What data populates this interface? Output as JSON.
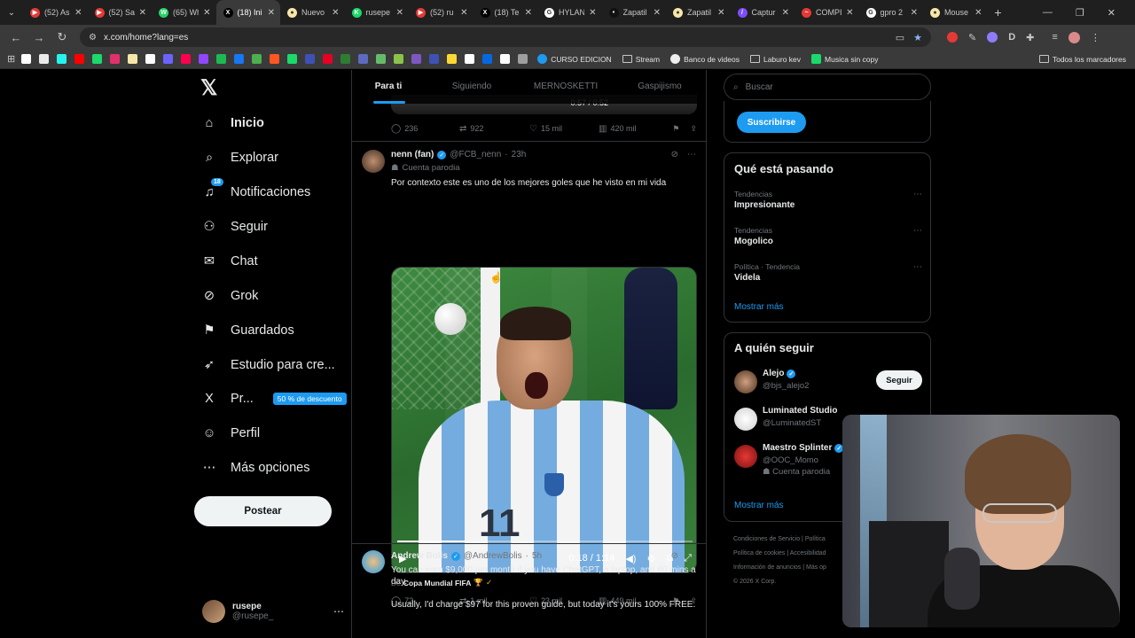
{
  "browser": {
    "tabs": [
      {
        "label": "(52) As",
        "fav_color": "#e53935",
        "fav_glyph": "▶"
      },
      {
        "label": "(52) Sa",
        "fav_color": "#e53935",
        "fav_glyph": "▶"
      },
      {
        "label": "(65) Wh",
        "fav_color": "#25d366",
        "fav_glyph": "W"
      },
      {
        "label": "(18) Ini",
        "fav_color": "#000000",
        "fav_glyph": "X",
        "active": true
      },
      {
        "label": "Nuevo",
        "fav_color": "#f6e6a8",
        "fav_glyph": "●"
      },
      {
        "label": "rusepe",
        "fav_color": "#1bd96a",
        "fav_glyph": "K"
      },
      {
        "label": "(52) ru",
        "fav_color": "#e53935",
        "fav_glyph": "▶"
      },
      {
        "label": "(18) Te",
        "fav_color": "#000000",
        "fav_glyph": "X"
      },
      {
        "label": "HYLAN",
        "fav_color": "#ffffff",
        "fav_glyph": "G"
      },
      {
        "label": "Zapatil",
        "fav_color": "#111111",
        "fav_glyph": "•"
      },
      {
        "label": "Zapatil",
        "fav_color": "#f6e6a8",
        "fav_glyph": "●"
      },
      {
        "label": "Captur",
        "fav_color": "#7c4dff",
        "fav_glyph": "/"
      },
      {
        "label": "COMPI",
        "fav_color": "#e53935",
        "fav_glyph": "~"
      },
      {
        "label": "gpro 2",
        "fav_color": "#ffffff",
        "fav_glyph": "G"
      },
      {
        "label": "Mouse",
        "fav_color": "#f6e6a8",
        "fav_glyph": "●"
      }
    ],
    "url": "x.com/home?lang=es",
    "bookmarks": [
      {
        "label": "",
        "color": "#ffffff"
      },
      {
        "label": "",
        "color": "#eaeaea"
      },
      {
        "label": "",
        "color": "#25f4ee"
      },
      {
        "label": "",
        "color": "#ff0000"
      },
      {
        "label": "",
        "color": "#1bd96a"
      },
      {
        "label": "",
        "color": "#e1306c"
      },
      {
        "label": "",
        "color": "#f6e6a8"
      },
      {
        "label": "",
        "color": "#ffffff"
      },
      {
        "label": "",
        "color": "#6c63ff"
      },
      {
        "label": "",
        "color": "#ff0050"
      },
      {
        "label": "",
        "color": "#9146ff"
      },
      {
        "label": "",
        "color": "#1db954"
      },
      {
        "label": "",
        "color": "#1877f2"
      },
      {
        "label": "",
        "color": "#4caf50"
      },
      {
        "label": "",
        "color": "#ff5722"
      },
      {
        "label": "",
        "color": "#1bd96a"
      },
      {
        "label": "",
        "color": "#3f51b5"
      },
      {
        "label": "",
        "color": "#e60023"
      },
      {
        "label": "",
        "color": "#2e7d32"
      },
      {
        "label": "",
        "color": "#5c6bc0"
      },
      {
        "label": "",
        "color": "#66bb6a"
      },
      {
        "label": "",
        "color": "#8bc34a"
      },
      {
        "label": "",
        "color": "#7e57c2"
      },
      {
        "label": "",
        "color": "#3f51b5"
      },
      {
        "label": "",
        "color": "#fdd835"
      },
      {
        "label": "",
        "color": "#ffffff"
      },
      {
        "label": "",
        "color": "#0668e1"
      },
      {
        "label": "",
        "color": "#ffffff"
      },
      {
        "label": "",
        "color": "#9e9e9e"
      }
    ],
    "bookmark_links": [
      {
        "label": "CURSO EDICION",
        "icon": "S"
      },
      {
        "label": "Stream",
        "icon": "folder"
      },
      {
        "label": "Banco de videos",
        "icon": "o"
      },
      {
        "label": "Laburo kev",
        "icon": "folder"
      },
      {
        "label": "Musica sin copy",
        "icon": "music"
      }
    ],
    "all_bookmarks": "Todos los marcadores"
  },
  "leftnav": {
    "items": [
      {
        "label": "Inicio",
        "icon": "home-icon",
        "glyph": "⌂",
        "bold": true
      },
      {
        "label": "Explorar",
        "icon": "search-icon",
        "glyph": "⌕"
      },
      {
        "label": "Notificaciones",
        "icon": "bell-icon",
        "glyph": "♫",
        "badge": "18"
      },
      {
        "label": "Seguir",
        "icon": "add-person-icon",
        "glyph": "⚇"
      },
      {
        "label": "Chat",
        "icon": "mail-icon",
        "glyph": "✉"
      },
      {
        "label": "Grok",
        "icon": "grok-icon",
        "glyph": "⊘"
      },
      {
        "label": "Guardados",
        "icon": "bookmark-icon",
        "glyph": "⚑"
      },
      {
        "label": "Estudio para cre...",
        "icon": "rocket-icon",
        "glyph": "➶"
      },
      {
        "label": "Pr...",
        "icon": "x-premium-icon",
        "glyph": "X",
        "promo": "50 % de descuento"
      },
      {
        "label": "Perfil",
        "icon": "person-icon",
        "glyph": "☺"
      },
      {
        "label": "Más opciones",
        "icon": "more-icon",
        "glyph": "⋯"
      }
    ],
    "post_label": "Postear",
    "profile": {
      "name": "rusepe",
      "handle": "@rusepe_"
    }
  },
  "timeline": {
    "tabs": [
      "Para ti",
      "Siguiendo",
      "MERNOSKETTI",
      "Gaspijismo"
    ],
    "prev_post": {
      "time": "0:57 / 0:52",
      "replies": "236",
      "reposts": "922",
      "likes": "15 mil",
      "views": "420 mil"
    },
    "post1": {
      "name": "nenn (fan)",
      "handle": "@FCB_nenn",
      "age": "23h",
      "parody": "Cuenta parodia",
      "text": "Por contexto este es uno de los mejores goles que he visto en mi vida",
      "video_time": "0:18 / 1:14",
      "progress": 0.24,
      "jersey_number": "11",
      "source_prefix": "De",
      "source": "Copa Mundial FIFA",
      "replies": "72",
      "reposts": "1 mil",
      "likes": "23 mil",
      "views": "449 mil"
    },
    "post2": {
      "name": "Andrew Bolis",
      "handle": "@AndrewBolis",
      "age": "5h",
      "text1": "You can earn $9,000 per month if you have ChatGPT, a laptop, and 60 mins a day.",
      "text2": "Usually, I'd charge $97 for this proven guide, but today it's yours 100% FREE."
    }
  },
  "rightcol": {
    "search_placeholder": "Buscar",
    "subscribe_label": "Suscribirse",
    "trends_title": "Qué está pasando",
    "trends": [
      {
        "context": "Tendencias",
        "name": "Impresionante"
      },
      {
        "context": "Tendencias",
        "name": "Mogolico"
      },
      {
        "context": "Política · Tendencia",
        "name": "Videla"
      }
    ],
    "show_more": "Mostrar más",
    "follow_title": "A quién seguir",
    "follow": [
      {
        "name": "Alejo",
        "handle": "@bjs_alejo2",
        "button": "Seguir",
        "verified": true
      },
      {
        "name": "Luminated Studio",
        "handle": "@LuminatedST",
        "button": "",
        "verified": false
      },
      {
        "name": "Maestro Splinter",
        "handle": "@OOC_Momo",
        "parody": "Cuenta parodia",
        "button": "",
        "verified": true
      }
    ],
    "follow_show_more": "Mostrar más",
    "footer": [
      "Condiciones de Servicio",
      "Política",
      "Política de cookies",
      "Accesibilidad",
      "Información de anuncios",
      "Más op",
      "© 2026 X Corp."
    ]
  },
  "colors": {
    "accent": "#1d9bf0",
    "bg": "#000000",
    "border": "#2f3336",
    "muted": "#71767b"
  }
}
